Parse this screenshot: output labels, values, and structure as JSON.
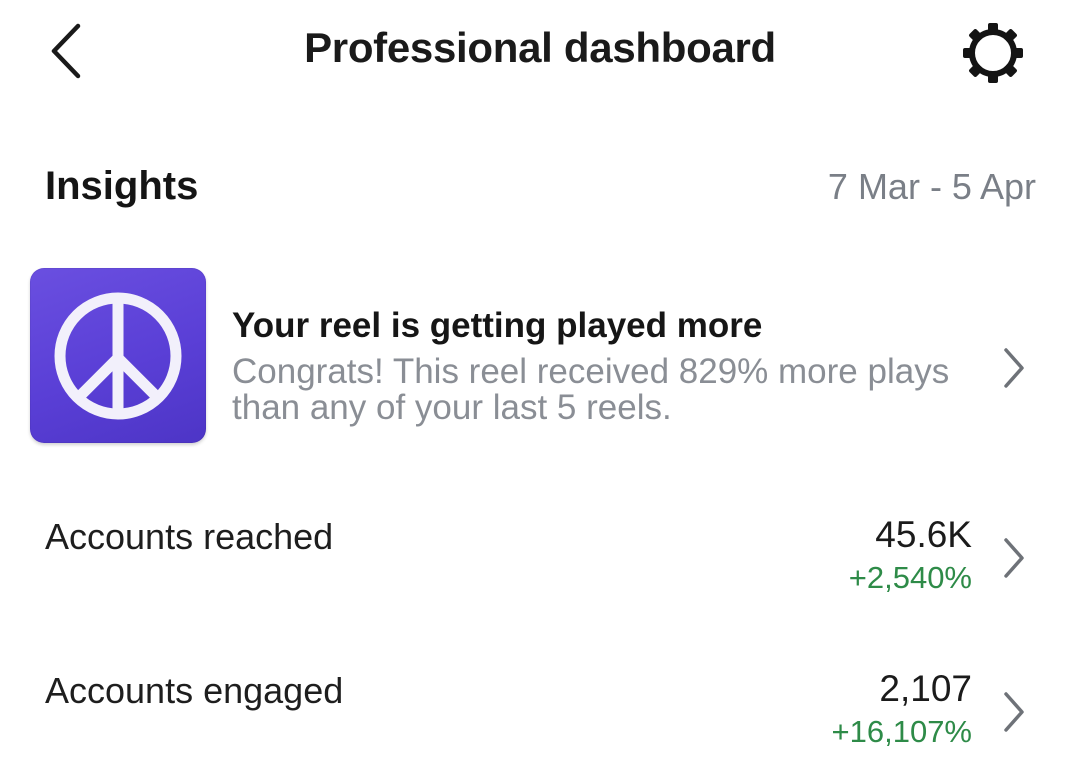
{
  "header": {
    "title": "Professional dashboard",
    "back_icon": "chevron-left-icon",
    "settings_icon": "gear-icon"
  },
  "insights": {
    "title": "Insights",
    "date_range": "7 Mar - 5 Apr"
  },
  "reel_card": {
    "thumbnail_icon": "peace-sign-icon",
    "thumbnail_color": "#5b40d8",
    "headline": "Your reel is getting played more",
    "description": "Congrats! This reel received 829% more plays than any of your last 5 reels."
  },
  "metrics": [
    {
      "label": "Accounts reached",
      "value": "45.6K",
      "delta": "+2,540%"
    },
    {
      "label": "Accounts engaged",
      "value": "2,107",
      "delta": "+16,107%"
    }
  ],
  "colors": {
    "positive": "#2e8b48",
    "muted_text": "#8a8e95",
    "accent_purple": "#5b40d8"
  }
}
